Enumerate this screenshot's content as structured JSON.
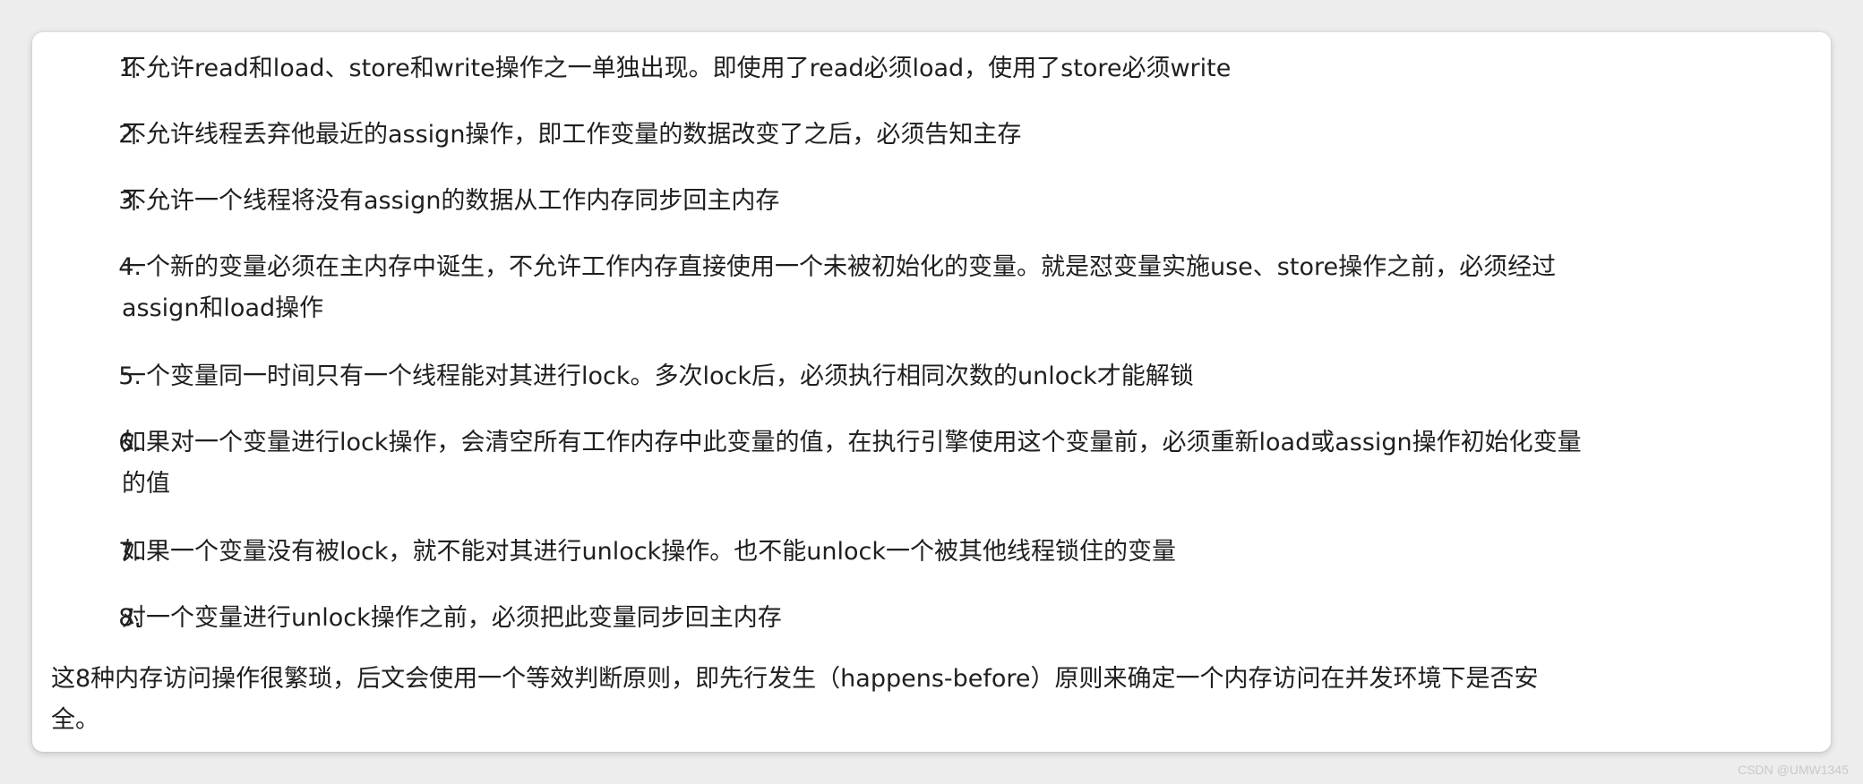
{
  "rules": [
    {
      "num": "1.",
      "line1": "不允许read和load、store和write操作之一单独出现。即使用了read必须load，使用了store必须write",
      "line2": ""
    },
    {
      "num": "2.",
      "line1": "不允许线程丢弃他最近的assign操作，即工作变量的数据改变了之后，必须告知主存",
      "line2": ""
    },
    {
      "num": "3.",
      "line1": "不允许一个线程将没有assign的数据从工作内存同步回主内存",
      "line2": ""
    },
    {
      "num": "4.",
      "line1": "一个新的变量必须在主内存中诞生，不允许工作内存直接使用一个未被初始化的变量。就是怼变量实施use、store操作之前，必须经过",
      "line2": "assign和load操作"
    },
    {
      "num": "5.",
      "line1": "一个变量同一时间只有一个线程能对其进行lock。多次lock后，必须执行相同次数的unlock才能解锁",
      "line2": ""
    },
    {
      "num": "6.",
      "line1": "如果对一个变量进行lock操作，会清空所有工作内存中此变量的值，在执行引擎使用这个变量前，必须重新load或assign操作初始化变量",
      "line2": "的值"
    },
    {
      "num": "7.",
      "line1": "如果一个变量没有被lock，就不能对其进行unlock操作。也不能unlock一个被其他线程锁住的变量",
      "line2": ""
    },
    {
      "num": "8.",
      "line1": "对一个变量进行unlock操作之前，必须把此变量同步回主内存",
      "line2": ""
    }
  ],
  "summary": {
    "line1": "这8种内存访问操作很繁琐，后文会使用一个等效判断原则，即先行发生（happens-before）原则来确定一个内存访问在并发环境下是否安",
    "line2": "全。"
  },
  "watermark": "CSDN @UMW1345"
}
